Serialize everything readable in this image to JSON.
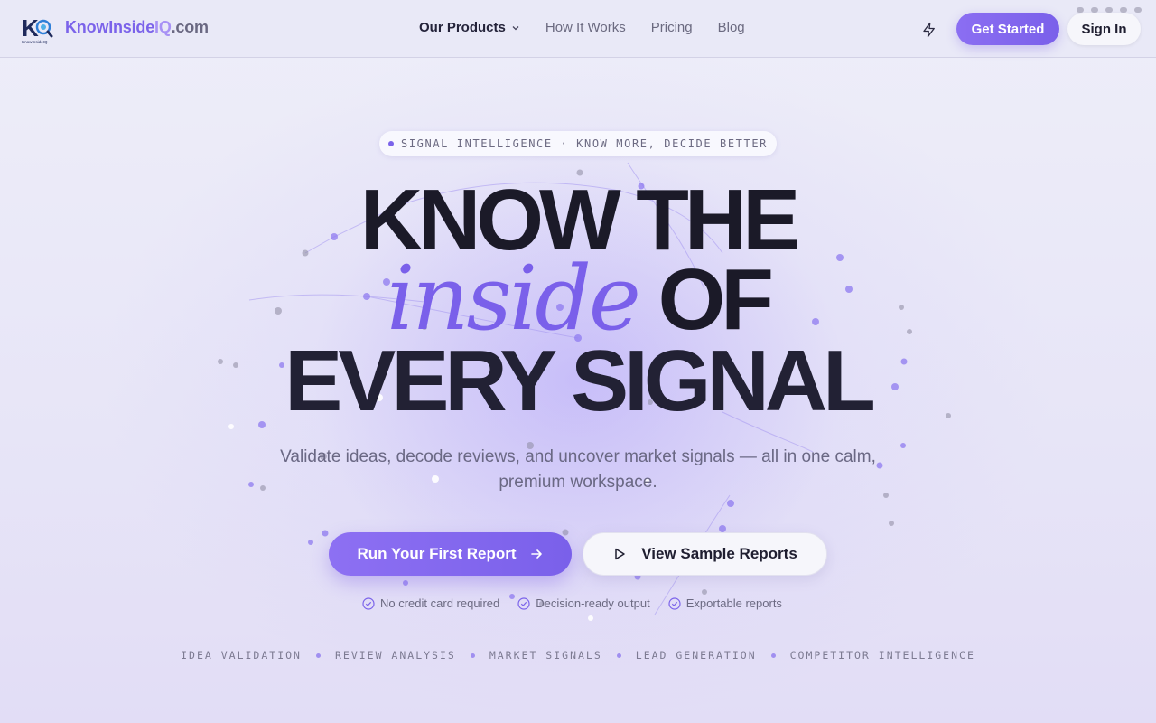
{
  "brand": {
    "part1": "KnowInside",
    "part2": "IQ",
    "part3": ".com",
    "logo_text": "KnowInsideIQ"
  },
  "nav": {
    "items": [
      {
        "label": "Our Products",
        "has_dropdown": true,
        "active": true
      },
      {
        "label": "How It Works"
      },
      {
        "label": "Pricing"
      },
      {
        "label": "Blog"
      }
    ]
  },
  "header": {
    "get_started": "Get Started",
    "sign_in": "Sign In",
    "bolt_icon": "bolt-icon"
  },
  "hero": {
    "eyebrow": "SIGNAL INTELLIGENCE · KNOW MORE, DECIDE BETTER",
    "line1": "KNOW THE",
    "line2_accent": "inside",
    "line2_rest": "OF",
    "line3": "EVERY SIGNAL",
    "subtitle": "Validate ideas, decode reviews, and uncover market signals — all in one calm, premium workspace.",
    "cta_primary": "Run Your First Report",
    "cta_secondary": "View Sample Reports",
    "checks": [
      "No credit card required",
      "Decision-ready output",
      "Exportable reports"
    ],
    "tags": [
      "IDEA VALIDATION",
      "REVIEW ANALYSIS",
      "MARKET SIGNALS",
      "LEAD GENERATION",
      "COMPETITOR INTELLIGENCE"
    ]
  },
  "colors": {
    "accent": "#7b63ea",
    "accent_light": "#a892f5",
    "text_dark": "#1b1a28",
    "background": "#ecebf8"
  }
}
